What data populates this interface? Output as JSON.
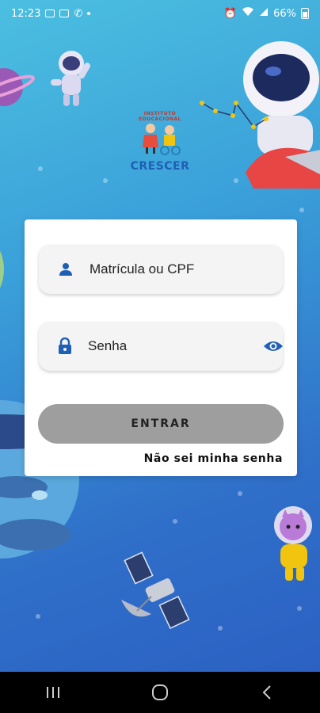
{
  "status_bar": {
    "time": "12:23",
    "battery": "66%"
  },
  "logo": {
    "top_text": "INSTITUTO EDUCACIONAL",
    "brand": "CRESCER"
  },
  "login": {
    "username_placeholder": "Matrícula ou CPF",
    "password_placeholder": "Senha",
    "submit_label": "ENTRAR",
    "forgot_label": "Não sei minha senha"
  },
  "icons": {
    "user": "person-icon",
    "lock": "lock-icon",
    "toggle": "eye-icon"
  },
  "colors": {
    "accent": "#1f5fb5",
    "button_disabled": "#9e9e9e",
    "background_top": "#4bbfe0",
    "background_bottom": "#2b5ec2"
  }
}
